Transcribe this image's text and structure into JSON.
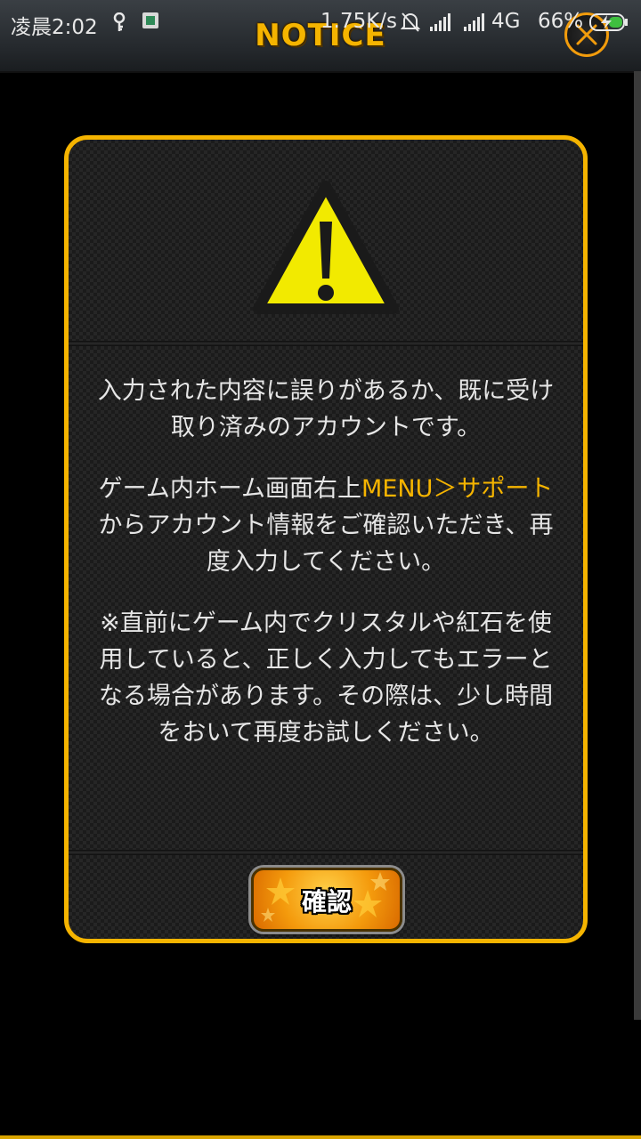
{
  "status_bar": {
    "time": "凌晨2:02",
    "speed": "1.75K/s",
    "network": "4G",
    "battery": "66%"
  },
  "header": {
    "title": "NOTICE"
  },
  "dialog": {
    "icon": "warning-triangle-icon",
    "paragraph1": "入力された内容に誤りがあるか、既に受け取り済みのアカウントです。",
    "paragraph2_pre": "ゲーム内ホーム画面右上",
    "paragraph2_highlight": "MENU＞サポート",
    "paragraph2_post": "からアカウント情報をご確認いただき、再度入力してください。",
    "paragraph3": "※直前にゲーム内でクリスタルや紅石を使用していると、正しく入力してもエラーとなる場合があります。その際は、少し時間をおいて再度お試しください。",
    "confirm_label": "確認"
  },
  "colors": {
    "accent": "#f5b400",
    "button": "#f49a0c",
    "warning": "#f2ea00"
  }
}
